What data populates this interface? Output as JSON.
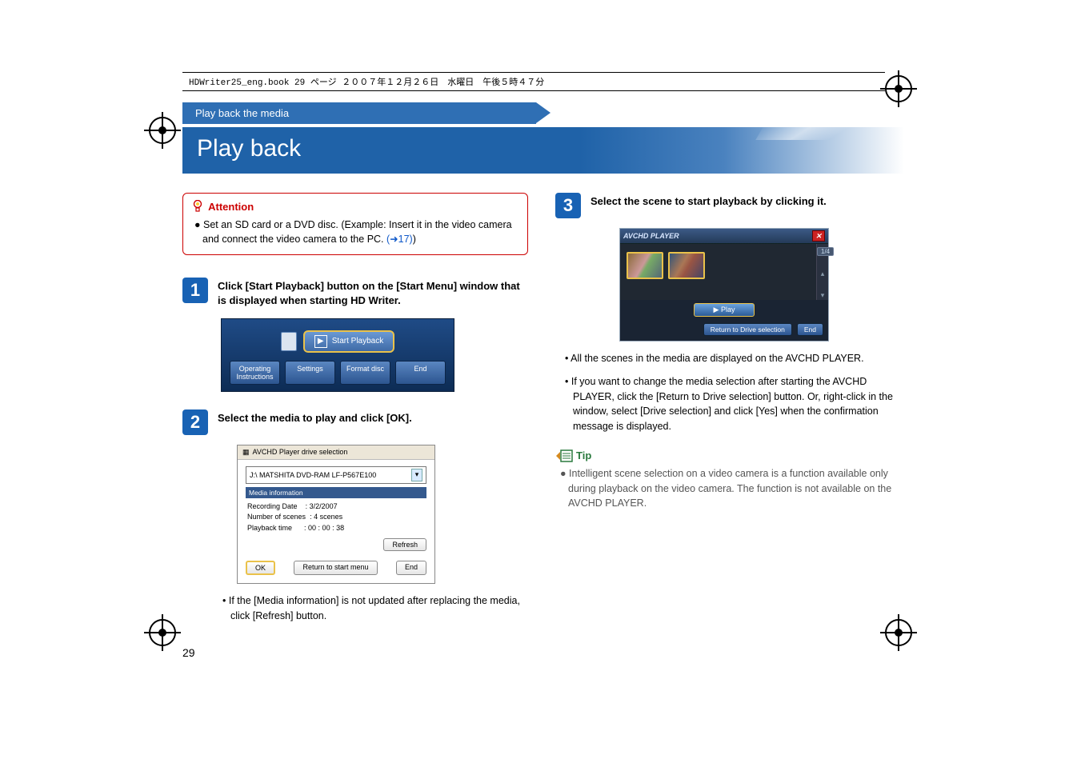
{
  "header_line": "HDWriter25_eng.book  29 ページ  ２００７年１２月２６日　水曜日　午後５時４７分",
  "breadcrumb": "Play back the media",
  "title": "Play back",
  "attention": {
    "label": "Attention",
    "body_prefix": "● Set an SD card or a DVD disc. (Example: Insert it in the video camera and connect the video camera to the PC. ",
    "body_link": "(➜17)",
    "body_suffix": ")"
  },
  "steps": {
    "s1": {
      "num": "1",
      "text": "Click [Start Playback] button on the [Start Menu] window that is displayed when starting HD Writer."
    },
    "s2": {
      "num": "2",
      "text": "Select the media to play and click [OK]."
    },
    "s3": {
      "num": "3",
      "text": "Select the scene to start playback by clicking it."
    }
  },
  "start_menu": {
    "card_label": "Start Playback",
    "btn1": "Operating Instructions",
    "btn2": "Settings",
    "btn3": "Format disc",
    "btn4": "End"
  },
  "drive_sel": {
    "title": "AVCHD Player drive selection",
    "drop_value": "J:\\ MATSHITA DVD-RAM LF-P567E100",
    "mi_head": "Media information",
    "rec_label": "Recording Date",
    "rec_val": ": 3/2/2007",
    "scenes_label": "Number of scenes",
    "scenes_val": ": 4 scenes",
    "pb_label": "Playback time",
    "pb_val": ": 00 : 00 : 38",
    "refresh": "Refresh",
    "ok": "OK",
    "ret": "Return to start menu",
    "end": "End"
  },
  "note_after_step2": "• If the [Media information] is not updated after replacing the media, click [Refresh] button.",
  "avchd": {
    "title": "AVCHD PLAYER",
    "count": "1/4",
    "play": "▶ Play",
    "ret": "Return to Drive selection",
    "end": "End"
  },
  "col2_bullets": {
    "b1": "• All the scenes in the media are displayed on the AVCHD PLAYER.",
    "b2": "• If you want to change the media selection after starting the AVCHD PLAYER, click the [Return to Drive selection] button. Or, right-click in the window, select [Drive selection] and click [Yes] when the confirmation message is displayed."
  },
  "tip": {
    "label": "Tip",
    "body": "● Intelligent scene selection on a video camera is a function available only during playback on the video camera. The function is not available on the AVCHD PLAYER."
  },
  "page_number": "29"
}
